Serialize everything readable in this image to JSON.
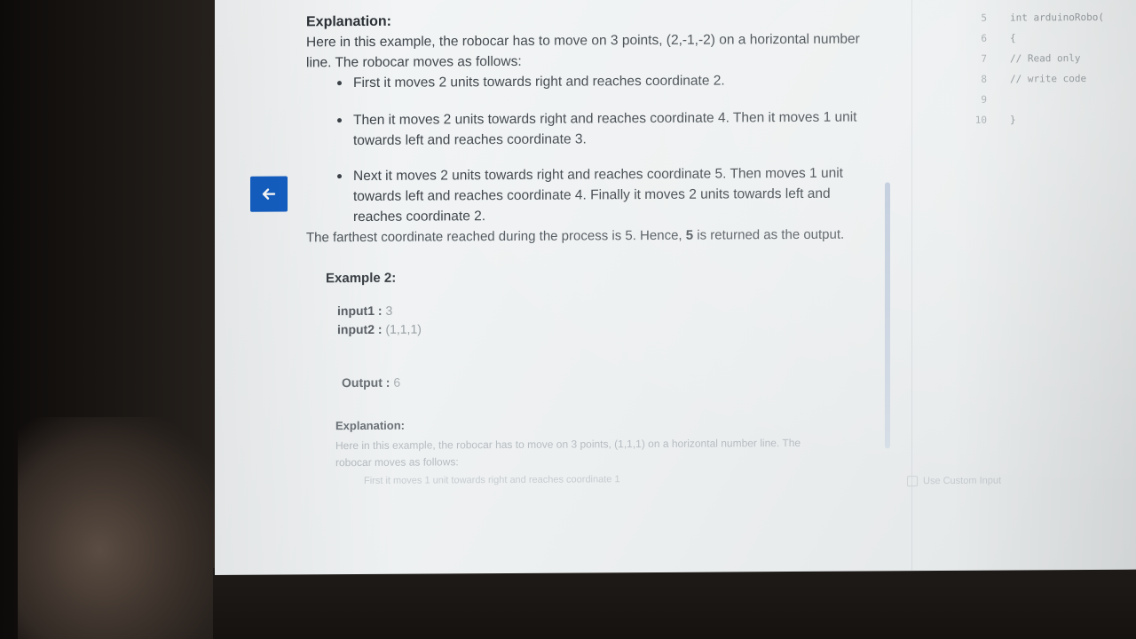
{
  "problem": {
    "explanation_heading": "Explanation:",
    "intro": "Here in this example, the robocar has to move on 3 points, (2,-1,-2) on a horizontal number line. The robocar moves as follows:",
    "steps": [
      "First it moves 2 units towards right and reaches coordinate 2.",
      "Then it moves 2 units towards right and reaches coordinate 4. Then it moves 1 unit towards left and reaches coordinate 3.",
      "Next it moves 2 units towards right and reaches coordinate 5. Then moves 1 unit towards left and reaches coordinate 4. Finally it moves 2 units towards left and reaches coordinate 2."
    ],
    "farthest_prefix": "The farthest coordinate reached during the process is 5. Hence,",
    "farthest_value": "5",
    "farthest_suffix": "is returned as the output.",
    "example2": {
      "heading": "Example 2:",
      "input1_label": "input1 :",
      "input1_value": "3",
      "input2_label": "input2 :",
      "input2_value": "(1,1,1)",
      "output_label": "Output :",
      "output_value": "6",
      "explanation_heading": "Explanation:",
      "explanation_text": "Here in this example, the robocar has to move on 3 points, (1,1,1) on a horizontal number line. The robocar moves as follows:",
      "first_step": "First it moves 1 unit towards right and reaches coordinate 1"
    }
  },
  "editor": {
    "lines": [
      {
        "num": "5",
        "code": "int arduinoRobo("
      },
      {
        "num": "6",
        "code": "{"
      },
      {
        "num": "7",
        "code": "    // Read only"
      },
      {
        "num": "8",
        "code": "    // write code"
      },
      {
        "num": "9",
        "code": ""
      },
      {
        "num": "10",
        "code": "}"
      }
    ],
    "custom_input_label": "Use Custom Input"
  },
  "colors": {
    "back_button": "#1560c4"
  },
  "icons": {
    "back": "arrow-left-icon"
  }
}
